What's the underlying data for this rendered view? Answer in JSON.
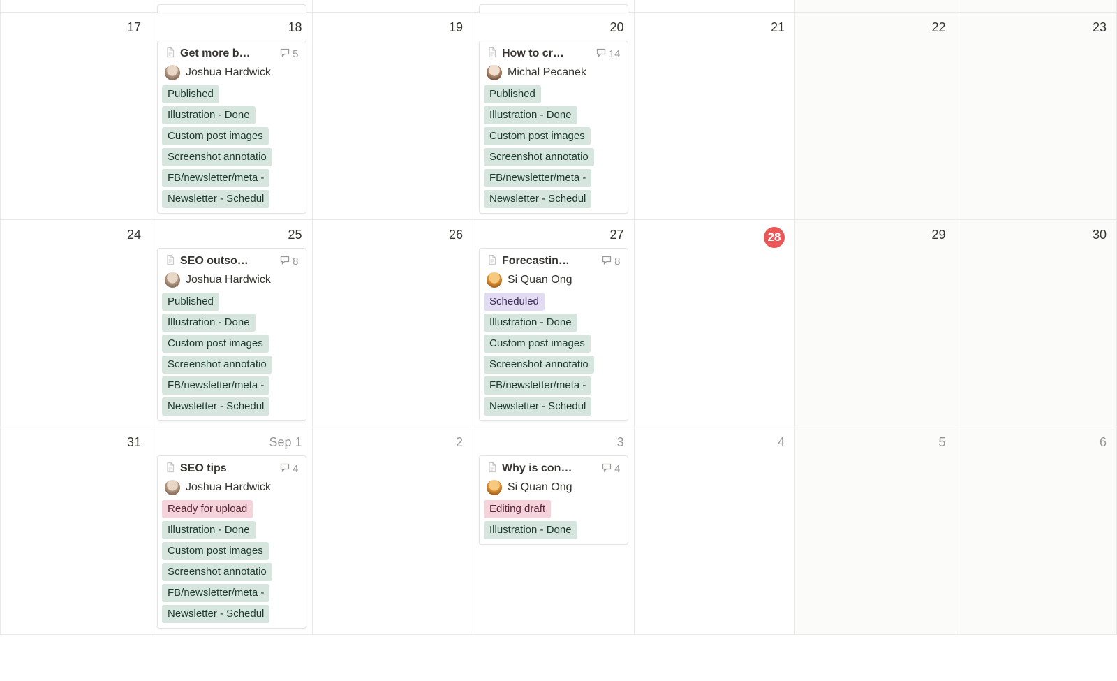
{
  "today_day": "28",
  "weeks": [
    {
      "days": [
        {
          "label": "17",
          "muted": false,
          "weekend": false,
          "card": null
        },
        {
          "label": "18",
          "muted": false,
          "weekend": false,
          "card": {
            "title": "Get more b…",
            "comments": "5",
            "author": "Joshua Hardwick",
            "avatar": "jh",
            "tags": [
              {
                "text": "Published",
                "c": "green"
              },
              {
                "text": "Illustration - Done",
                "c": "green"
              },
              {
                "text": "Custom post images",
                "c": "green"
              },
              {
                "text": "Screenshot annotatio",
                "c": "green"
              },
              {
                "text": "FB/newsletter/meta -",
                "c": "green"
              },
              {
                "text": "Newsletter - Schedul",
                "c": "green"
              }
            ]
          }
        },
        {
          "label": "19",
          "muted": false,
          "weekend": false,
          "card": null
        },
        {
          "label": "20",
          "muted": false,
          "weekend": false,
          "card": {
            "title": "How to cr…",
            "comments": "14",
            "author": "Michal Pecanek",
            "avatar": "mp",
            "tags": [
              {
                "text": "Published",
                "c": "green"
              },
              {
                "text": "Illustration - Done",
                "c": "green"
              },
              {
                "text": "Custom post images",
                "c": "green"
              },
              {
                "text": "Screenshot annotatio",
                "c": "green"
              },
              {
                "text": "FB/newsletter/meta -",
                "c": "green"
              },
              {
                "text": "Newsletter - Schedul",
                "c": "green"
              }
            ]
          }
        },
        {
          "label": "21",
          "muted": false,
          "weekend": false,
          "card": null
        },
        {
          "label": "22",
          "muted": false,
          "weekend": true,
          "card": null
        },
        {
          "label": "23",
          "muted": false,
          "weekend": true,
          "card": null
        }
      ]
    },
    {
      "days": [
        {
          "label": "24",
          "muted": false,
          "weekend": false,
          "card": null
        },
        {
          "label": "25",
          "muted": false,
          "weekend": false,
          "card": {
            "title": "SEO outso…",
            "comments": "8",
            "author": "Joshua Hardwick",
            "avatar": "jh",
            "tags": [
              {
                "text": "Published",
                "c": "green"
              },
              {
                "text": "Illustration - Done",
                "c": "green"
              },
              {
                "text": "Custom post images",
                "c": "green"
              },
              {
                "text": "Screenshot annotatio",
                "c": "green"
              },
              {
                "text": "FB/newsletter/meta -",
                "c": "green"
              },
              {
                "text": "Newsletter - Schedul",
                "c": "green"
              }
            ]
          }
        },
        {
          "label": "26",
          "muted": false,
          "weekend": false,
          "card": null
        },
        {
          "label": "27",
          "muted": false,
          "weekend": false,
          "card": {
            "title": "Forecastin…",
            "comments": "8",
            "author": "Si Quan Ong",
            "avatar": "sq",
            "tags": [
              {
                "text": "Scheduled",
                "c": "purple"
              },
              {
                "text": "Illustration - Done",
                "c": "green"
              },
              {
                "text": "Custom post images",
                "c": "green"
              },
              {
                "text": "Screenshot annotatio",
                "c": "green"
              },
              {
                "text": "FB/newsletter/meta -",
                "c": "green"
              },
              {
                "text": "Newsletter - Schedul",
                "c": "green"
              }
            ]
          }
        },
        {
          "label": "28",
          "muted": false,
          "weekend": false,
          "card": null,
          "today": true
        },
        {
          "label": "29",
          "muted": false,
          "weekend": true,
          "card": null
        },
        {
          "label": "30",
          "muted": false,
          "weekend": true,
          "card": null
        }
      ]
    },
    {
      "days": [
        {
          "label": "31",
          "muted": false,
          "weekend": false,
          "card": null
        },
        {
          "label": "Sep 1",
          "muted": true,
          "weekend": false,
          "card": {
            "title": "SEO tips",
            "comments": "4",
            "author": "Joshua Hardwick",
            "avatar": "jh",
            "tags": [
              {
                "text": "Ready for upload",
                "c": "pink"
              },
              {
                "text": "Illustration - Done",
                "c": "green"
              },
              {
                "text": "Custom post images",
                "c": "green"
              },
              {
                "text": "Screenshot annotatio",
                "c": "green"
              },
              {
                "text": "FB/newsletter/meta -",
                "c": "green"
              },
              {
                "text": "Newsletter - Schedul",
                "c": "green"
              }
            ]
          }
        },
        {
          "label": "2",
          "muted": true,
          "weekend": false,
          "card": null
        },
        {
          "label": "3",
          "muted": true,
          "weekend": false,
          "card": {
            "title": "Why is con…",
            "comments": "4",
            "author": "Si Quan Ong",
            "avatar": "sq",
            "tags": [
              {
                "text": "Editing draft",
                "c": "pink"
              },
              {
                "text": "Illustration - Done",
                "c": "green"
              }
            ]
          }
        },
        {
          "label": "4",
          "muted": true,
          "weekend": false,
          "card": null
        },
        {
          "label": "5",
          "muted": true,
          "weekend": true,
          "card": null
        },
        {
          "label": "6",
          "muted": true,
          "weekend": true,
          "card": null
        }
      ]
    }
  ]
}
